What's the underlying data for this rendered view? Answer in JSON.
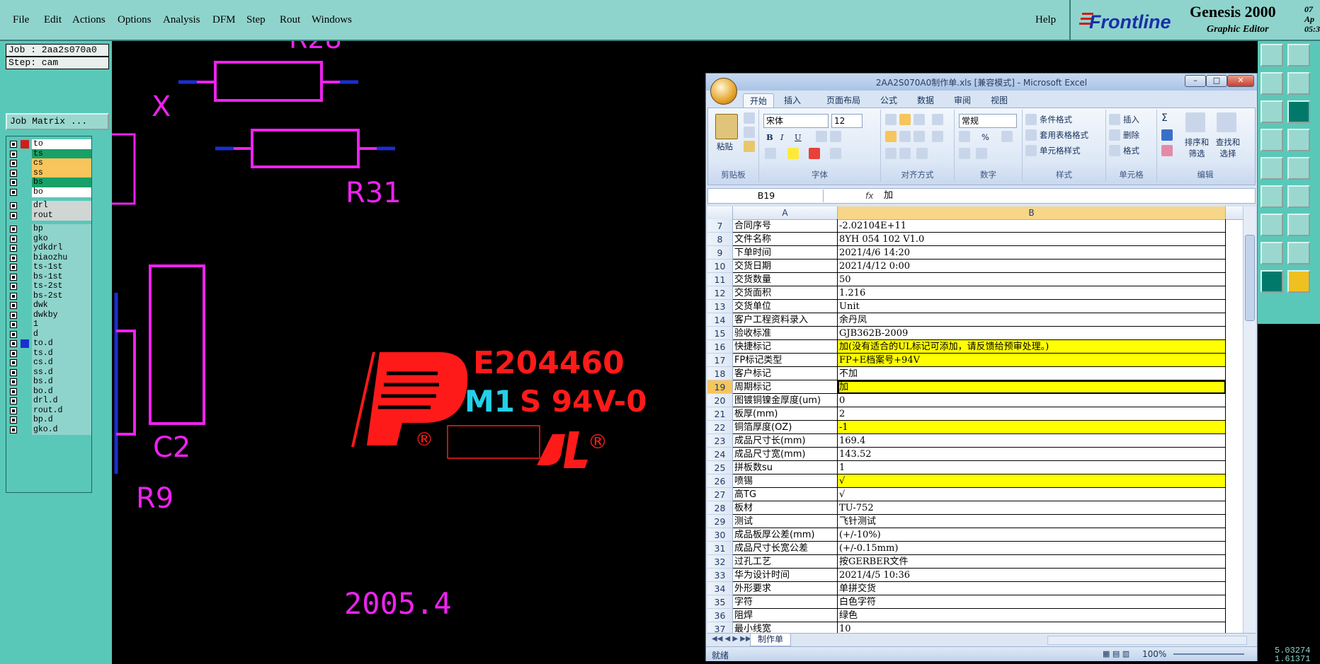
{
  "menubar": {
    "items": [
      "File",
      "Edit",
      "Actions",
      "Options",
      "Analysis",
      "DFM",
      "Step",
      "Rout",
      "Windows"
    ],
    "help": "Help"
  },
  "brand": {
    "logo_text": "Frontline",
    "title": "Genesis 2000",
    "subtitle": "Graphic Editor",
    "time_line1": "07 Ap",
    "time_line2": "05:3"
  },
  "left_panel": {
    "job": "Job : 2aa2s070a0",
    "step": "Step: cam",
    "job_matrix_button": "Job Matrix ...",
    "layers": [
      {
        "name": "to",
        "color": "#ffffff",
        "selected": false
      },
      {
        "name": "ts",
        "color": "#18a068",
        "selected": false
      },
      {
        "name": "cs",
        "color": "#f7c55c",
        "selected": false
      },
      {
        "name": "ss",
        "color": "#f7c55c",
        "selected": false
      },
      {
        "name": "bs",
        "color": "#18a068",
        "selected": false
      },
      {
        "name": "bo",
        "color": "#ffffff",
        "selected": false
      },
      {
        "name": "drl",
        "color": "#cfd6d4",
        "selected": false
      },
      {
        "name": "rout",
        "color": "#cfd6d4",
        "selected": false
      },
      {
        "name": "bp",
        "color": "#8fd4cc",
        "selected": false
      },
      {
        "name": "gko",
        "color": "#8fd4cc",
        "selected": false
      },
      {
        "name": "ydkdrl",
        "color": "#8fd4cc",
        "selected": false
      },
      {
        "name": "biaozhu",
        "color": "#8fd4cc",
        "selected": false
      },
      {
        "name": "ts-1st",
        "color": "#8fd4cc",
        "selected": false
      },
      {
        "name": "bs-1st",
        "color": "#8fd4cc",
        "selected": false
      },
      {
        "name": "ts-2st",
        "color": "#8fd4cc",
        "selected": false
      },
      {
        "name": "bs-2st",
        "color": "#8fd4cc",
        "selected": false
      },
      {
        "name": "dwk",
        "color": "#8fd4cc",
        "selected": false
      },
      {
        "name": "dwkby",
        "color": "#8fd4cc",
        "selected": false
      },
      {
        "name": "1",
        "color": "#8fd4cc",
        "selected": false
      },
      {
        "name": "d",
        "color": "#8fd4cc",
        "selected": false
      },
      {
        "name": "to.d",
        "color": "#8fd4cc",
        "selected": true
      },
      {
        "name": "ts.d",
        "color": "#8fd4cc",
        "selected": false
      },
      {
        "name": "cs.d",
        "color": "#8fd4cc",
        "selected": false
      },
      {
        "name": "ss.d",
        "color": "#8fd4cc",
        "selected": false
      },
      {
        "name": "bs.d",
        "color": "#8fd4cc",
        "selected": false
      },
      {
        "name": "bo.d",
        "color": "#8fd4cc",
        "selected": false
      },
      {
        "name": "drl.d",
        "color": "#8fd4cc",
        "selected": false
      },
      {
        "name": "rout.d",
        "color": "#8fd4cc",
        "selected": false
      },
      {
        "name": "bp.d",
        "color": "#8fd4cc",
        "selected": false
      },
      {
        "name": "gko.d",
        "color": "#8fd4cc",
        "selected": false
      }
    ]
  },
  "canvas": {
    "labels": {
      "r28": "R28",
      "x": "X",
      "r31": "R31",
      "c2": "C2",
      "r9": "R9",
      "ul_number": "E204460",
      "m1": "M1",
      "rating": "S 94V-0",
      "date_code": "2005.4",
      "reg_mark": "®"
    }
  },
  "excel": {
    "title": "2AA2S070A0制作单.xls  [兼容模式] - Microsoft Excel",
    "tabs": [
      "开始",
      "插入",
      "页面布局",
      "公式",
      "数据",
      "审阅",
      "视图"
    ],
    "clipboard": {
      "paste": "粘贴",
      "group": "剪贴板"
    },
    "font": {
      "name": "宋体",
      "size": "12",
      "bold": "B",
      "italic": "I",
      "underline": "U",
      "group": "字体"
    },
    "alignment": {
      "group": "对齐方式"
    },
    "number": {
      "format": "常规",
      "percent": "%",
      "group": "数字"
    },
    "styles": {
      "conditional": "条件格式",
      "table": "套用表格格式",
      "cell": "单元格样式",
      "group": "样式"
    },
    "cells": {
      "insert": "插入",
      "delete": "删除",
      "format": "格式",
      "group": "单元格"
    },
    "editing": {
      "sigma": "Σ",
      "sort": "排序和筛选",
      "find": "查找和选择",
      "group": "编辑"
    },
    "name_box": "B19",
    "fx": "fx",
    "formula": "加",
    "col_a": "A",
    "col_b": "B",
    "rows": [
      {
        "n": "7",
        "a": "合同序号",
        "b": "-2.02104E+11",
        "y": false
      },
      {
        "n": "8",
        "a": "文件名称",
        "b": "8YH 054 102 V1.0",
        "y": false
      },
      {
        "n": "9",
        "a": "下单时间",
        "b": "2021/4/6 14:20",
        "y": false
      },
      {
        "n": "10",
        "a": "交货日期",
        "b": "2021/4/12 0:00",
        "y": false
      },
      {
        "n": "11",
        "a": "交货数量",
        "b": "50",
        "y": false
      },
      {
        "n": "12",
        "a": "交货面积",
        "b": "1.216",
        "y": false
      },
      {
        "n": "13",
        "a": "交货单位",
        "b": "Unit",
        "y": false
      },
      {
        "n": "14",
        "a": "客户工程资料录入",
        "b": "余丹凤",
        "y": false
      },
      {
        "n": "15",
        "a": "验收标准",
        "b": "GJB362B-2009",
        "y": false
      },
      {
        "n": "16",
        "a": "快捷标记",
        "b": "加(没有适合的UL标记可添加，请反馈给预审处理。)",
        "y": true
      },
      {
        "n": "17",
        "a": "FP标记类型",
        "b": "FP+E档案号+94V",
        "y": true
      },
      {
        "n": "18",
        "a": "客户标记",
        "b": "不加",
        "y": false
      },
      {
        "n": "19",
        "a": "周期标记",
        "b": "加",
        "y": true
      },
      {
        "n": "20",
        "a": "图镀铜镍金厚度(um)",
        "b": "0",
        "y": false
      },
      {
        "n": "21",
        "a": "板厚(mm)",
        "b": "2",
        "y": false
      },
      {
        "n": "22",
        "a": "铜箔厚度(OZ)",
        "b": "-1",
        "y": true
      },
      {
        "n": "23",
        "a": "成品尺寸长(mm)",
        "b": "169.4",
        "y": false
      },
      {
        "n": "24",
        "a": "成品尺寸宽(mm)",
        "b": "143.52",
        "y": false
      },
      {
        "n": "25",
        "a": "拼板数su",
        "b": "1",
        "y": false
      },
      {
        "n": "26",
        "a": "喷锡",
        "b": "√",
        "y": true
      },
      {
        "n": "27",
        "a": "高TG",
        "b": "√",
        "y": false
      },
      {
        "n": "28",
        "a": "板材",
        "b": "TU-752",
        "y": false
      },
      {
        "n": "29",
        "a": "测试",
        "b": "飞针测试",
        "y": false
      },
      {
        "n": "30",
        "a": "成品板厚公差(mm)",
        "b": "(+/-10%)",
        "y": false
      },
      {
        "n": "31",
        "a": "成品尺寸长宽公差",
        "b": "(+/-0.15mm)",
        "y": false
      },
      {
        "n": "32",
        "a": "过孔工艺",
        "b": "按GERBER文件",
        "y": false
      },
      {
        "n": "33",
        "a": "华为设计时间",
        "b": "2021/4/5 10:36",
        "y": false
      },
      {
        "n": "34",
        "a": "外形要求",
        "b": "单拼交货",
        "y": false
      },
      {
        "n": "35",
        "a": "字符",
        "b": "白色字符",
        "y": false
      },
      {
        "n": "36",
        "a": "阻焊",
        "b": "绿色",
        "y": false
      },
      {
        "n": "37",
        "a": "最小线宽",
        "b": "10",
        "y": false
      }
    ],
    "active_row": "19",
    "sheet_tab": "制作单",
    "status": "就绪",
    "zoom": "100%"
  },
  "coords": {
    "line1": "5.03274",
    "line2": "1.61371"
  }
}
